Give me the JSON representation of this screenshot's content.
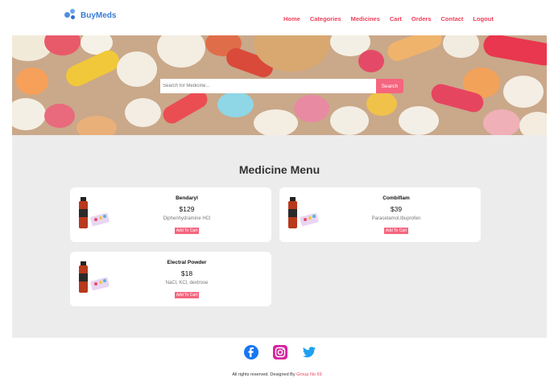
{
  "brand": {
    "name": "BuyMeds"
  },
  "nav": [
    {
      "label": "Home"
    },
    {
      "label": "Categories"
    },
    {
      "label": "Medicines"
    },
    {
      "label": "Cart"
    },
    {
      "label": "Orders"
    },
    {
      "label": "Contact"
    },
    {
      "label": "Logout"
    }
  ],
  "search": {
    "placeholder": "Search for Medicine...",
    "button": "Search"
  },
  "menu": {
    "title": "Medicine Menu",
    "items": [
      {
        "name": "Bendaryl",
        "price": "$129",
        "ingredients": "Diphenhydramine HCl",
        "button": "Add To Cart"
      },
      {
        "name": "Combiflam",
        "price": "$39",
        "ingredients": "Paracetamol,Ibuprofen",
        "button": "Add To Cart"
      },
      {
        "name": "Electral Powder",
        "price": "$18",
        "ingredients": "NaCl, KCl, dextrose",
        "button": "Add To Cart"
      }
    ]
  },
  "footer": {
    "social": [
      "facebook-icon",
      "instagram-icon",
      "twitter-icon"
    ],
    "credits_prefix": "All rights reserved. Designed By",
    "credits_group": "Group No 69"
  },
  "colors": {
    "accent": "#f5657f",
    "nav": "#f03f5c",
    "brand": "#3a7bd5",
    "panel": "#ececec"
  }
}
